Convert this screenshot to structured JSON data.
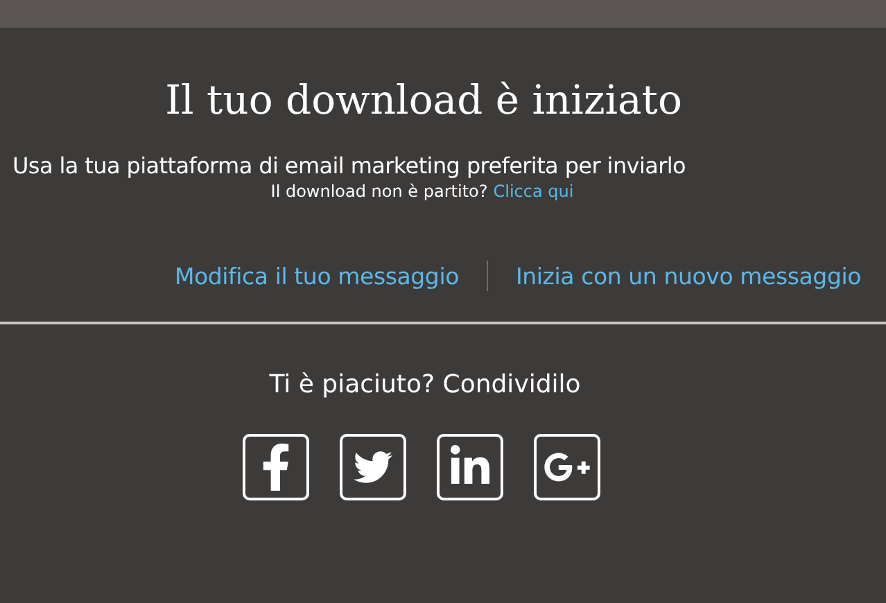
{
  "title": "Il tuo download è iniziato",
  "subtitle": "Usa la tua piattaforma di email marketing preferita per inviarlo",
  "retry": {
    "text": "Il download non è partito?",
    "link": "Clicca qui"
  },
  "actions": [
    "Modifica il tuo messaggio",
    "Inizia con un nuovo messaggio"
  ],
  "share": {
    "title": "Ti è piaciuto? Condividilo",
    "networks": [
      {
        "kind": "facebook"
      },
      {
        "kind": "twitter"
      },
      {
        "kind": "linkedin"
      },
      {
        "kind": "googleplus"
      }
    ]
  }
}
